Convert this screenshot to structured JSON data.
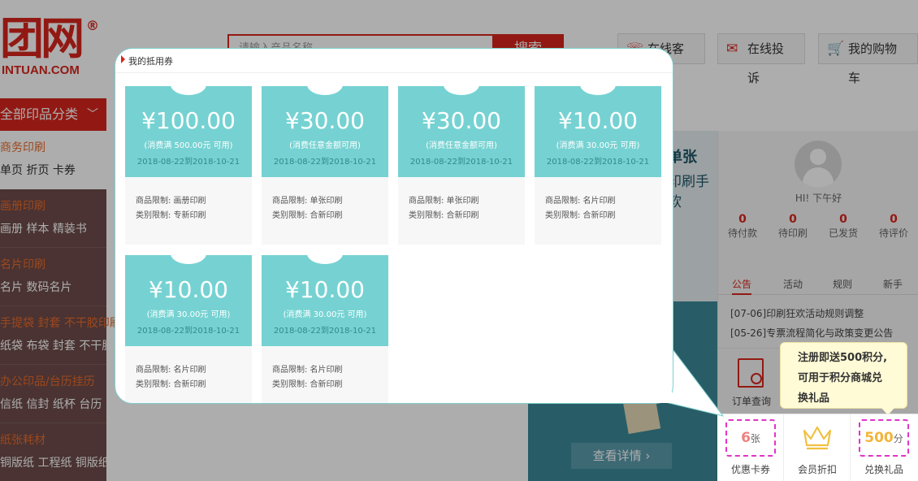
{
  "header": {
    "logo_mark": "团网",
    "logo_reg": "®",
    "logo_text": "INTUAN.COM",
    "search_placeholder": "请输入产品名称",
    "search_button": "搜索",
    "service_label": "在线客服",
    "complain_label": "在线投诉",
    "cart_label": "我的购物车"
  },
  "category": {
    "header": "全部印品分类",
    "items": [
      {
        "title": "商务印刷",
        "links": "单页 折页 卡券"
      },
      {
        "title": "画册印刷",
        "links": "画册 样本 精装书"
      },
      {
        "title": "名片印刷",
        "links": "名片 数码名片"
      },
      {
        "title": "手提袋 封套 不干胶印刷",
        "links": "纸袋 布袋 封套 不干胶"
      },
      {
        "title": "办公印品/台历挂历",
        "links": "信纸 信封 纸杯 台历"
      },
      {
        "title": "纸张耗材",
        "links": "铜版纸 工程纸 铜版纸"
      }
    ]
  },
  "banner": {
    "title1": "单张",
    "title2": "印刷手软",
    "detail_button": "查看详情 ›"
  },
  "user": {
    "greeting": "HI! 下午好",
    "stats": [
      {
        "num": "0",
        "label": "待付款"
      },
      {
        "num": "0",
        "label": "待印刷"
      },
      {
        "num": "0",
        "label": "已发货"
      },
      {
        "num": "0",
        "label": "待评价"
      }
    ],
    "tabs": [
      "公告",
      "活动",
      "规则",
      "新手"
    ],
    "notices": [
      "[07-06]印刷狂欢活动规则调整",
      "[05-26]专票流程简化与政策变更公告"
    ],
    "order_query": "订单查询"
  },
  "tooltip": {
    "line1": "注册即送500积分,",
    "line2": "可用于积分商城兑",
    "line3": "换礼品"
  },
  "bottom_bar": {
    "coupon_count": "6",
    "coupon_unit": "张",
    "coupon_label": "优惠卡券",
    "member_label": "会员折扣",
    "points_count": "500",
    "points_unit": "分",
    "points_label": "兑换礼品"
  },
  "popup": {
    "title": "我的抵用券",
    "coupons": [
      {
        "amount": "¥100.00",
        "condition": "(消费满 500.00元 可用)",
        "date": "2018-08-22到2018-10-21",
        "product": "商品限制: 画册印刷",
        "category": "类别限制: 专新印刷"
      },
      {
        "amount": "¥30.00",
        "condition": "(消费任意金额可用)",
        "date": "2018-08-22到2018-10-21",
        "product": "商品限制: 单张印刷",
        "category": "类别限制: 合新印刷"
      },
      {
        "amount": "¥30.00",
        "condition": "(消费任意金额可用)",
        "date": "2018-08-22到2018-10-21",
        "product": "商品限制: 单张印刷",
        "category": "类别限制: 合新印刷"
      },
      {
        "amount": "¥10.00",
        "condition": "(消费满 30.00元 可用)",
        "date": "2018-08-22到2018-10-21",
        "product": "商品限制: 名片印刷",
        "category": "类别限制: 合新印刷"
      },
      {
        "amount": "¥10.00",
        "condition": "(消费满 30.00元 可用)",
        "date": "2018-08-22到2018-10-21",
        "product": "商品限制: 名片印刷",
        "category": "类别限制: 合新印刷"
      },
      {
        "amount": "¥10.00",
        "condition": "(消费满 30.00元 可用)",
        "date": "2018-08-22到2018-10-21",
        "product": "商品限制: 名片印刷",
        "category": "类别限制: 合新印刷"
      }
    ]
  },
  "colors": {
    "brand_red": "#d8261d",
    "coupon_teal": "#76d2d2",
    "highlight_magenta": "#e234c9"
  }
}
